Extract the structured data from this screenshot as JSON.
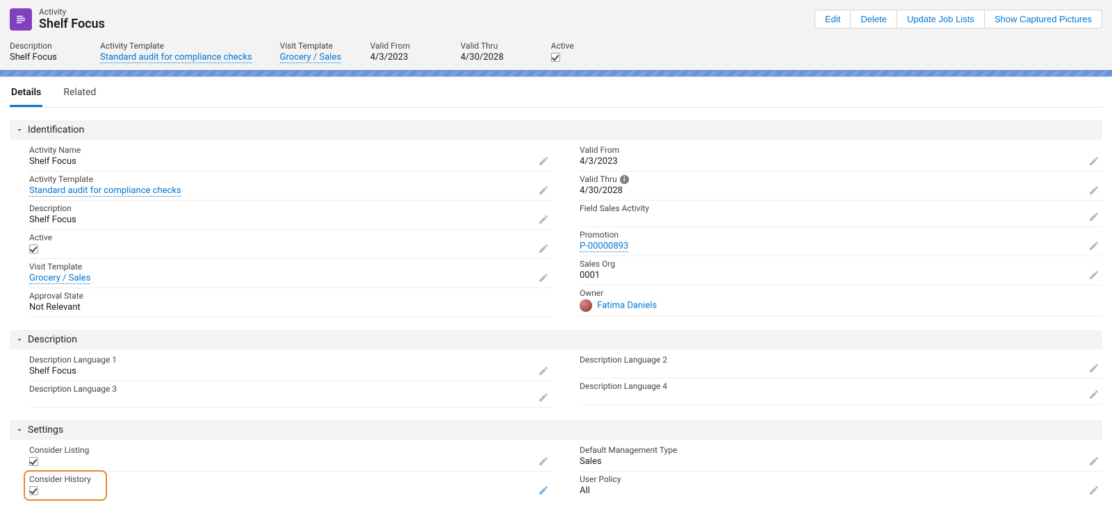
{
  "header": {
    "object_type": "Activity",
    "object_name": "Shelf Focus",
    "actions": {
      "edit": "Edit",
      "delete": "Delete",
      "update_job_lists": "Update Job Lists",
      "show_captured_pictures": "Show Captured Pictures"
    },
    "highlights": {
      "description_label": "Description",
      "description_value": "Shelf Focus",
      "activity_template_label": "Activity Template",
      "activity_template_value": "Standard audit for compliance checks",
      "visit_template_label": "Visit Template",
      "visit_template_value": "Grocery / Sales",
      "valid_from_label": "Valid From",
      "valid_from_value": "4/3/2023",
      "valid_thru_label": "Valid Thru",
      "valid_thru_value": "4/30/2028",
      "active_label": "Active"
    }
  },
  "tabs": {
    "details": "Details",
    "related": "Related"
  },
  "sections": {
    "identification": {
      "title": "Identification",
      "left": {
        "activity_name_label": "Activity Name",
        "activity_name_value": "Shelf Focus",
        "activity_template_label": "Activity Template",
        "activity_template_value": "Standard audit for compliance checks",
        "description_label": "Description",
        "description_value": "Shelf Focus",
        "active_label": "Active",
        "visit_template_label": "Visit Template",
        "visit_template_value": "Grocery / Sales",
        "approval_state_label": "Approval State",
        "approval_state_value": "Not Relevant"
      },
      "right": {
        "valid_from_label": "Valid From",
        "valid_from_value": "4/3/2023",
        "valid_thru_label": "Valid Thru",
        "valid_thru_value": "4/30/2028",
        "field_sales_activity_label": "Field Sales Activity",
        "field_sales_activity_value": "",
        "promotion_label": "Promotion",
        "promotion_value": "P-00000893",
        "sales_org_label": "Sales Org",
        "sales_org_value": "0001",
        "owner_label": "Owner",
        "owner_value": "Fatima Daniels"
      }
    },
    "description": {
      "title": "Description",
      "left": {
        "lang1_label": "Description Language 1",
        "lang1_value": "Shelf Focus",
        "lang3_label": "Description Language 3",
        "lang3_value": ""
      },
      "right": {
        "lang2_label": "Description Language 2",
        "lang2_value": "",
        "lang4_label": "Description Language 4",
        "lang4_value": ""
      }
    },
    "settings": {
      "title": "Settings",
      "left": {
        "consider_listing_label": "Consider Listing",
        "consider_history_label": "Consider History"
      },
      "right": {
        "default_mgmt_type_label": "Default Management Type",
        "default_mgmt_type_value": "Sales",
        "user_policy_label": "User Policy",
        "user_policy_value": "All"
      }
    }
  }
}
